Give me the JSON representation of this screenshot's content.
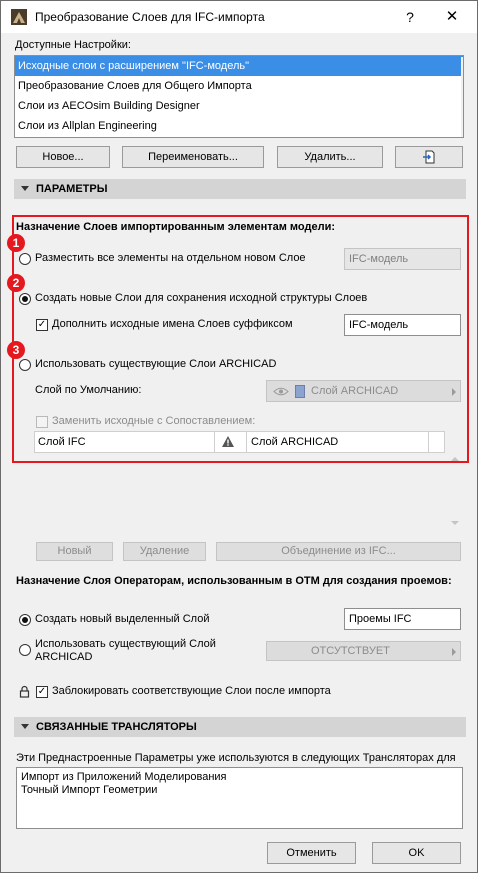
{
  "window": {
    "title": "Преобразование Слоев для IFC-импорта",
    "help_label": "?",
    "close_label": "✕"
  },
  "presets": {
    "label": "Доступные Настройки:",
    "items": [
      {
        "label": "Исходные слои с расширением \"IFC-модель\"",
        "selected": true
      },
      {
        "label": "Преобразование Слоев для Общего Импорта",
        "selected": false
      },
      {
        "label": "Слои из AECOsim Building Designer",
        "selected": false
      },
      {
        "label": "Слои из Allplan Engineering",
        "selected": false
      }
    ],
    "buttons": {
      "new": "Новое...",
      "rename": "Переименовать...",
      "delete": "Удалить..."
    }
  },
  "parameters": {
    "header": "ПАРАМЕТРЫ",
    "assign_title": "Назначение Слоев импортированным элементам модели:",
    "option1": {
      "label": "Разместить все элементы на отдельном новом Слое",
      "field": "IFC-модель",
      "badge": "1"
    },
    "option2": {
      "label": "Создать новые Слои для сохранения исходной структуры Слоев",
      "badge": "2",
      "checkbox_label": "Дополнить исходные имена Слоев суффиксом",
      "field": "IFC-модель"
    },
    "option3": {
      "label": "Использовать существующие Слои ARCHICAD",
      "badge": "3",
      "default_label": "Слой по Умолчанию:",
      "default_value": "Слой ARCHICAD",
      "replace_label": "Заменить исходные с Сопоставлением:"
    },
    "table": {
      "col1": "Слой IFC",
      "col2": "Слой ARCHICAD"
    },
    "table_buttons": {
      "new": "Новый",
      "delete": "Удаление",
      "merge": "Объединение из IFC..."
    }
  },
  "openings": {
    "title": "Назначение Слоя Операторам, использованным в ОТМ для создания проемов:",
    "create_label": "Создать новый выделенный Слой",
    "create_field": "Проемы IFC",
    "use_label_1": "Использовать существующий Слой",
    "use_label_2": "ARCHICAD",
    "use_value": "ОТСУТСТВУЕТ",
    "lock_label": "Заблокировать соответствующие Слои после импорта"
  },
  "translators": {
    "header": "СВЯЗАННЫЕ ТРАНСЛЯТОРЫ",
    "description": "Эти Преднастроенные Параметры уже используются в следующих Трансляторах для",
    "list": [
      "Импорт из Приложений Моделирования",
      "Точный Импорт Геометрии"
    ]
  },
  "footer": {
    "cancel": "Отменить",
    "ok": "OK"
  },
  "colors": {
    "selection": "#3a8ee6",
    "annotation_red": "#e5171f"
  }
}
